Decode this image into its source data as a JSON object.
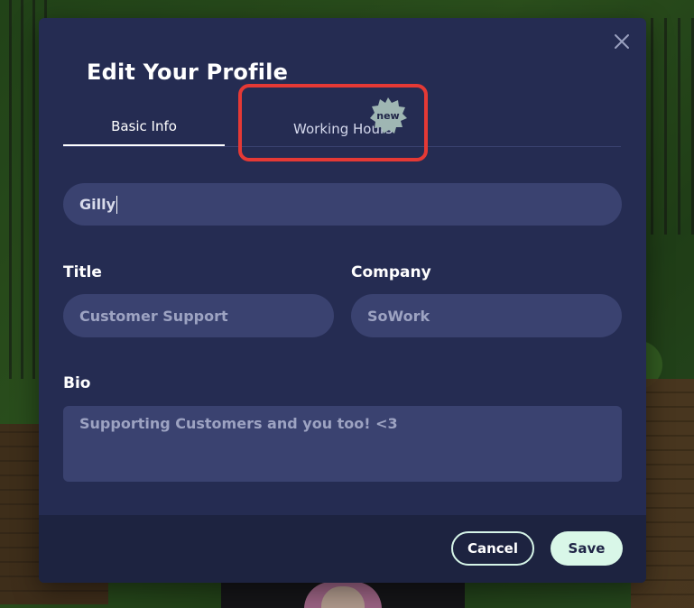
{
  "modal": {
    "title": "Edit Your Profile",
    "tabs": [
      {
        "label": "Basic Info",
        "active": true
      },
      {
        "label": "Working Hours",
        "active": false,
        "badge": "new"
      }
    ],
    "fields": {
      "name": {
        "value": "Gilly"
      },
      "title": {
        "label": "Title",
        "value": "Customer Support"
      },
      "company": {
        "label": "Company",
        "value": "SoWork"
      },
      "bio": {
        "label": "Bio",
        "value": "Supporting Customers and you too! <3"
      }
    },
    "buttons": {
      "cancel": "Cancel",
      "save": "Save"
    }
  },
  "colors": {
    "modal_bg": "#252c52",
    "field_bg": "#3a4270",
    "footer_bg": "#1d2340",
    "save_bg": "#d9f7e8",
    "highlight": "#e53935",
    "badge": "#9fb6b3"
  },
  "icons": {
    "close": "close-icon",
    "badge": "starburst-badge-icon"
  }
}
